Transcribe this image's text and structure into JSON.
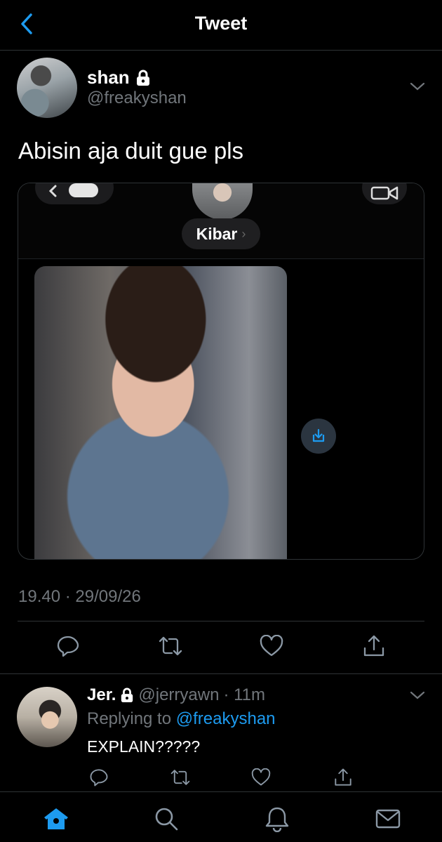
{
  "header": {
    "title": "Tweet",
    "back_icon": "chevron-left-icon"
  },
  "tweet": {
    "author_name": "shan",
    "author_handle": "@freakyshan",
    "protected_icon": "lock-icon",
    "text": "Abisin aja duit gue pls",
    "media": {
      "contact_name": "Kibar",
      "contact_chevron": "›"
    },
    "timestamp": "19.40 · 29/09/26",
    "actions": [
      "reply-icon",
      "retweet-icon",
      "like-icon",
      "share-icon"
    ]
  },
  "reply": {
    "author_name": "Jer.",
    "author_handle": "@jerryawn",
    "time": "· 11m",
    "replying_prefix": "Replying to ",
    "replying_handle": "@freakyshan",
    "text": "EXPLAIN?????"
  },
  "tabbar": {
    "tabs": [
      "home-icon",
      "search-icon",
      "notifications-icon",
      "messages-icon"
    ],
    "active_color": "#1d9bf0"
  },
  "colors": {
    "accent": "#1d9bf0",
    "muted": "#71767b",
    "background": "#000000"
  }
}
